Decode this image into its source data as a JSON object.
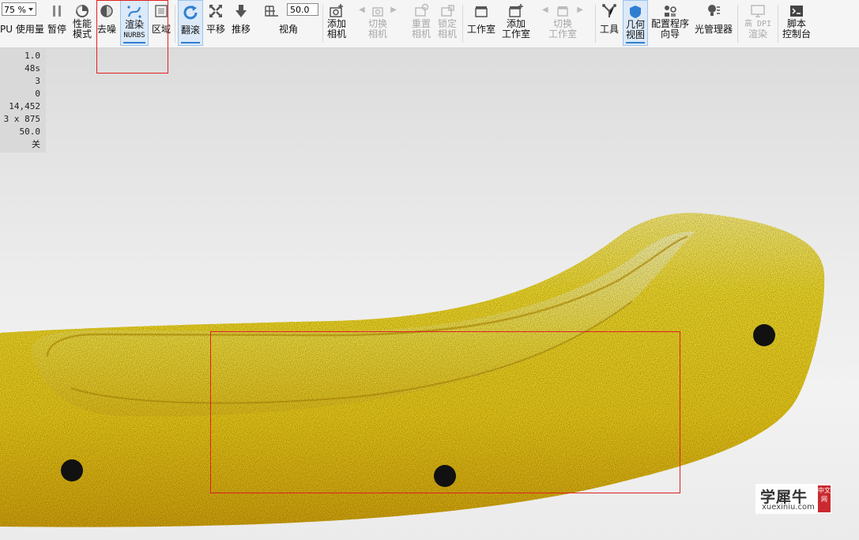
{
  "toolbar": {
    "zoom": "75 %",
    "fov_value": "50.0",
    "buttons": {
      "gpu_usage": "PU 使用量",
      "pause": "暂停",
      "performance": [
        "性能",
        "模式"
      ],
      "denoise": "去噪",
      "render_nurbs": [
        "渲染",
        "NURBS"
      ],
      "region": "区域",
      "tumble": "翻滚",
      "pan": "平移",
      "dolly": "推移",
      "fov": "视角",
      "add_camera": [
        "添加",
        "相机"
      ],
      "switch_camera": [
        "切换",
        "相机"
      ],
      "reset_camera": [
        "重置",
        "相机"
      ],
      "lock_camera": [
        "锁定",
        "相机"
      ],
      "studio": "工作室",
      "add_studio": [
        "添加",
        "工作室"
      ],
      "switch_studio": [
        "切换",
        "工作室"
      ],
      "tools": "工具",
      "geometry_view": [
        "几何",
        "视图"
      ],
      "config_wizard": [
        "配置程序",
        "向导"
      ],
      "light_manager": "光管理器",
      "hidpi_render": [
        "高 DPI",
        "渲染"
      ],
      "script_console": [
        "脚本",
        "控制台"
      ]
    }
  },
  "stats": [
    "1.0",
    "48s",
    "3",
    "0",
    "14,452",
    "3 x 875",
    "50.0",
    "关"
  ],
  "watermark": {
    "name": "学犀牛",
    "url": "xuexiniu.com",
    "tag": "中文网"
  },
  "colors": {
    "accent": "#2f7fd0",
    "model": "#f2d21a",
    "highlight": "#e02020"
  }
}
